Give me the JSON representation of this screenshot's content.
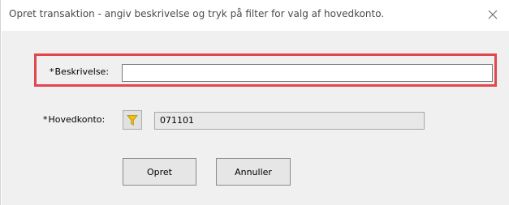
{
  "window": {
    "title": "Opret transaktion - angiv beskrivelse og tryk på filter for valg af hovedkonto.",
    "close_icon": "close-icon"
  },
  "form": {
    "beskrivelse": {
      "required_mark": "*",
      "label": "Beskrivelse:",
      "value": ""
    },
    "hovedkonto": {
      "required_mark": "*",
      "label": "Hovedkonto:",
      "filter_icon": "filter-funnel-icon",
      "value": "071101"
    }
  },
  "buttons": {
    "create_label": "Opret",
    "cancel_label": "Annuller"
  },
  "colors": {
    "highlight_border": "#e0474f",
    "filter_icon": "#f2c200",
    "client_background": "#f0f0f0"
  }
}
